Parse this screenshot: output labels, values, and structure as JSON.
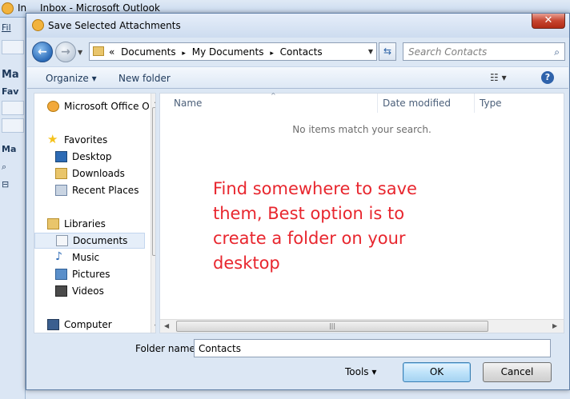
{
  "outlook": {
    "title_prefix": "In",
    "title": "Inbox - Microsoft Outlook",
    "left_labels": [
      "Fil",
      "Ma",
      "Fav",
      "Ma"
    ]
  },
  "dialog": {
    "title": "Save Selected Attachments",
    "close_glyph": "✕",
    "address": {
      "crumbs": [
        "«",
        "Documents",
        "▸",
        "My Documents",
        "▸",
        "Contacts"
      ]
    },
    "search_placeholder": "Search Contacts",
    "toolbar": {
      "organize": "Organize ▾",
      "new_folder": "New folder",
      "views_glyph": "☷ ▾",
      "help_glyph": "?"
    },
    "nav": {
      "items": [
        {
          "label": "Microsoft Office O",
          "icon": "outlook-icon",
          "color": "#f2a93b"
        },
        {
          "label": "Favorites",
          "icon": "star-icon",
          "color": "#f5c21b"
        },
        {
          "label": "Desktop",
          "icon": "desktop-icon",
          "color": "#2d6bb5"
        },
        {
          "label": "Downloads",
          "icon": "downloads-folder-icon",
          "color": "#e9c56b"
        },
        {
          "label": "Recent Places",
          "icon": "recent-places-icon",
          "color": "#8ca3bf"
        },
        {
          "label": "Libraries",
          "icon": "libraries-icon",
          "color": "#e9c56b"
        },
        {
          "label": "Documents",
          "icon": "documents-icon",
          "color": "#c9d4e2"
        },
        {
          "label": "Music",
          "icon": "music-icon",
          "color": "#2d6bb5"
        },
        {
          "label": "Pictures",
          "icon": "pictures-icon",
          "color": "#5a8fca"
        },
        {
          "label": "Videos",
          "icon": "videos-icon",
          "color": "#4a4a4a"
        },
        {
          "label": "Computer",
          "icon": "computer-icon",
          "color": "#3b5f8f"
        }
      ],
      "selected": "Documents"
    },
    "columns": [
      "Name",
      "Date modified",
      "Type"
    ],
    "empty_message": "No items match your search.",
    "annotation": "Find somewhere to save them, Best option is to create a folder on your desktop",
    "filename_label": "Folder name:",
    "filename_value": "Contacts",
    "tools_label": "Tools  ▾",
    "ok_label": "OK",
    "cancel_label": "Cancel"
  }
}
